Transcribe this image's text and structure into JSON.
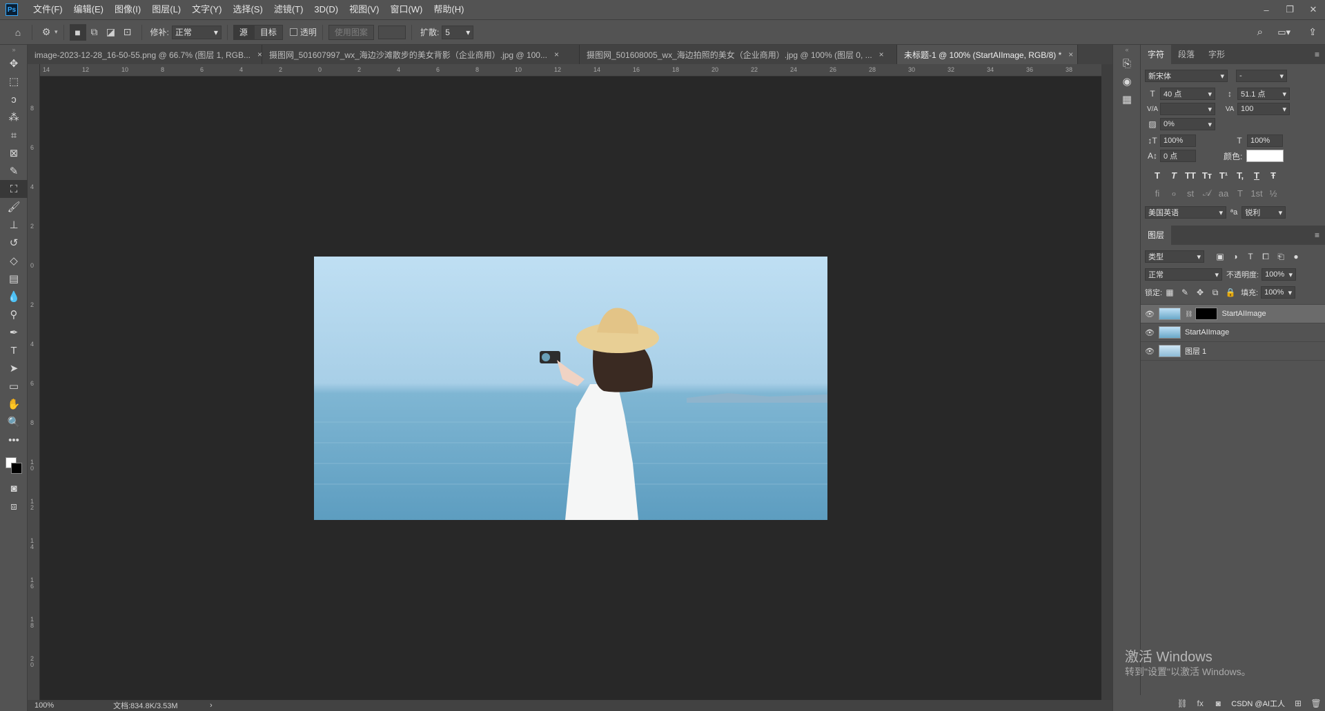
{
  "app": {
    "logo": "Ps"
  },
  "menu": [
    "文件(F)",
    "编辑(E)",
    "图像(I)",
    "图层(L)",
    "文字(Y)",
    "选择(S)",
    "滤镜(T)",
    "3D(D)",
    "视图(V)",
    "窗口(W)",
    "帮助(H)"
  ],
  "window_controls": {
    "minimize": "–",
    "restore": "❐",
    "close": "✕"
  },
  "options": {
    "patch_label": "修补:",
    "patch_mode": "正常",
    "source_btn": "源",
    "target_btn": "目标",
    "transparent_label": "透明",
    "use_pattern_btn": "使用图案",
    "diffusion_label": "扩散:",
    "diffusion_value": "5"
  },
  "tabs": [
    {
      "label": "image-2023-12-28_16-50-55.png @ 66.7% (图层 1, RGB...",
      "close": "×"
    },
    {
      "label": "摄图网_501607997_wx_海边沙滩散步的美女背影（企业商用）.jpg @ 100...",
      "close": "×"
    },
    {
      "label": "摄图网_501608005_wx_海边拍照的美女（企业商用）.jpg @ 100% (图层 0, ...",
      "close": "×"
    },
    {
      "label": "未标题-1 @ 100% (StartAIImage, RGB/8) *",
      "close": "×"
    }
  ],
  "ruler_top": [
    "14",
    "12",
    "10",
    "8",
    "6",
    "4",
    "2",
    "0",
    "2",
    "4",
    "6",
    "8",
    "10",
    "12",
    "14",
    "16",
    "18",
    "20",
    "22",
    "24",
    "26",
    "28",
    "30",
    "32",
    "34",
    "36",
    "38"
  ],
  "ruler_left": [
    "8",
    "6",
    "4",
    "2",
    "0",
    "2",
    "4",
    "6",
    "8",
    "1 0",
    "1 2",
    "1 4",
    "1 6",
    "1 8",
    "2 0"
  ],
  "status": {
    "zoom": "100%",
    "doc": "文档:834.8K/3.53M",
    "arrow": "›"
  },
  "character_panel": {
    "tabs": [
      "字符",
      "段落",
      "字形"
    ],
    "font_family": "新宋体",
    "font_style": "-",
    "font_size": "40 点",
    "leading": "51.1 点",
    "kerning_label": "V/A",
    "tracking": "100",
    "scale_pct": "0%",
    "vscale": "100%",
    "hscale": "100%",
    "baseline": "0 点",
    "color_label": "颜色:",
    "style_glyphs": [
      "T",
      "T",
      "TT",
      "Tт",
      "T¹",
      "T,",
      "T",
      "Ŧ"
    ],
    "ot_glyphs": [
      "ﬁ",
      "ℴ",
      "st",
      "𝒜",
      "aa",
      "T",
      "1st",
      "½"
    ],
    "language": "美国英语",
    "aa_label": "ªa",
    "antialias": "锐利"
  },
  "layers_panel": {
    "title": "图层",
    "filter": "类型",
    "blend": "正常",
    "opacity_label": "不透明度:",
    "opacity": "100%",
    "lock_label": "锁定:",
    "fill_label": "填充:",
    "fill": "100%",
    "layers": [
      {
        "name": "StartAIImage",
        "selected": true,
        "mask": true
      },
      {
        "name": "StartAIImage",
        "selected": false,
        "mask": false
      },
      {
        "name": "图层 1",
        "selected": false,
        "mask": false
      }
    ]
  },
  "watermark": {
    "line1": "激活 Windows",
    "line2": "转到\"设置\"以激活 Windows。"
  },
  "csdn": "CSDN @AI工人"
}
